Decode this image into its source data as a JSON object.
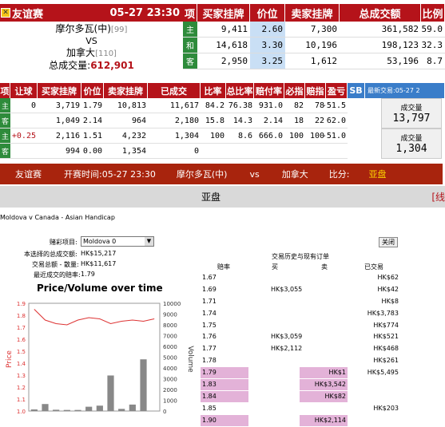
{
  "match_header": {
    "league": "友谊赛",
    "time": "05-27 23:30"
  },
  "teams": {
    "home": "摩尔多瓦(中)",
    "home_rank": "[99]",
    "vs": "VS",
    "away": "加拿大",
    "away_rank": "[110]",
    "total_label": "总成交量:",
    "total_value": "612,901"
  },
  "top_headers": {
    "item": "项",
    "buy": "买家挂牌",
    "price": "价位",
    "sell": "卖家挂牌",
    "volume": "总成交额",
    "ratio": "比例"
  },
  "top_rows": [
    {
      "label": "主",
      "buy": "9,411",
      "price": "2.60",
      "sell": "7,300",
      "volume": "361,582",
      "ratio": "59.0"
    },
    {
      "label": "和",
      "buy": "14,618",
      "price": "3.30",
      "sell": "10,196",
      "volume": "198,123",
      "ratio": "32.3"
    },
    {
      "label": "客",
      "buy": "2,950",
      "price": "3.25",
      "sell": "1,612",
      "volume": "53,196",
      "ratio": "8.7"
    }
  ],
  "second_headers": {
    "item": "项",
    "handicap": "让球",
    "buy": "买家挂牌",
    "price": "价位",
    "sell": "卖家挂牌",
    "done": "已成交",
    "ratio": "比率",
    "total_ratio": "总比率",
    "odds_rate": "赔付率",
    "must_win": "必指",
    "lose_idx": "赔指",
    "profit": "盈亏",
    "sb": "SB",
    "latest_label": "最新交易:",
    "latest_time": "05-27 2"
  },
  "second_rows": [
    {
      "label": "主",
      "handicap": "0",
      "buy": "3,719",
      "price": "1.79",
      "sell": "10,813",
      "done": "11,617",
      "ratio": "84.2",
      "total_ratio": "76.38",
      "odds_rate": "931.0",
      "must_win": "82",
      "lose_idx": "78",
      "profit": "-51.5"
    },
    {
      "label": "客",
      "handicap": "",
      "buy": "1,049",
      "price": "2.14",
      "sell": "964",
      "done": "2,180",
      "ratio": "15.8",
      "total_ratio": "14.3",
      "odds_rate": "2.14",
      "must_win": "18",
      "lose_idx": "22",
      "profit": "62.0"
    },
    {
      "label": "主",
      "handicap": "+0.25",
      "buy": "2,116",
      "price": "1.51",
      "sell": "4,232",
      "done": "1,304",
      "ratio": "100",
      "total_ratio": "8.6",
      "odds_rate": "666.0",
      "must_win": "100",
      "lose_idx": "100",
      "profit": "-51.0"
    },
    {
      "label": "客",
      "handicap": "",
      "buy": "994",
      "price": "0.00",
      "sell": "1,354",
      "done": "0",
      "ratio": "",
      "total_ratio": "",
      "odds_rate": "",
      "must_win": "",
      "lose_idx": "",
      "profit": ""
    }
  ],
  "volume_boxes": [
    {
      "label": "成交量",
      "value": "13,797"
    },
    {
      "label": "成交量",
      "value": "1,304"
    }
  ],
  "info_bar": {
    "league": "友谊赛",
    "start_label": "开赛时间:",
    "start_time": "05-27 23:30",
    "home": "摩尔多瓦(中)",
    "vs": "vs",
    "away": "加拿大",
    "score_label": "比分:",
    "market": "亚盘"
  },
  "section_title": "亚盘",
  "section_right": "[线",
  "detail": {
    "heading": "Moldova v Canada - Asian Handicap",
    "select_label": "赌彩项目:",
    "select_value": "Moldova 0",
    "matched_label": "本选择的总成交额:",
    "matched_value": "HK$15,217",
    "total_label": "交易总额 - 散量:",
    "total_value": "HK$11,617",
    "last_label": "最近成交的赔率:",
    "last_value": "1.79",
    "close_btn": "关闭",
    "table_title": "交易历史与现有订单",
    "col_odds": "赔率",
    "col_buy": "买",
    "col_sell": "卖",
    "col_done": "已交易",
    "rows": [
      {
        "odds": "1.67",
        "buy": "",
        "sell": "",
        "done": "HK$62"
      },
      {
        "odds": "1.69",
        "buy": "HK$3,055",
        "sell": "",
        "done": "HK$42"
      },
      {
        "odds": "1.71",
        "buy": "",
        "sell": "",
        "done": "HK$8"
      },
      {
        "odds": "1.74",
        "buy": "",
        "sell": "",
        "done": "HK$3,783"
      },
      {
        "odds": "1.75",
        "buy": "",
        "sell": "",
        "done": "HK$774"
      },
      {
        "odds": "1.76",
        "buy": "HK$3,059",
        "sell": "",
        "done": "HK$521"
      },
      {
        "odds": "1.77",
        "buy": "HK$2,112",
        "sell": "",
        "done": "HK$468"
      },
      {
        "odds": "1.78",
        "buy": "",
        "sell": "",
        "done": "HK$261"
      },
      {
        "odds": "1.79",
        "buy": "",
        "sell": "HK$1",
        "done": "HK$5,495"
      },
      {
        "odds": "1.83",
        "buy": "",
        "sell": "HK$3,542",
        "done": ""
      },
      {
        "odds": "1.84",
        "buy": "",
        "sell": "HK$82",
        "done": ""
      },
      {
        "odds": "1.85",
        "buy": "",
        "sell": "",
        "done": "HK$203"
      },
      {
        "odds": "1.90",
        "buy": "",
        "sell": "HK$2,114",
        "done": ""
      }
    ]
  },
  "chart_data": {
    "type": "line",
    "title": "Price/Volume over time",
    "ylabel": "Price",
    "y2label": "Volume",
    "ylim": [
      1.0,
      1.9
    ],
    "y2lim": [
      0,
      10000
    ],
    "price_ticks": [
      "1.9",
      "1.8",
      "1.7",
      "1.6",
      "1.5",
      "1.4",
      "1.3",
      "1.2",
      "1.1",
      "1.0"
    ],
    "volume_ticks": [
      "10000",
      "9000",
      "8000",
      "7000",
      "6000",
      "5000",
      "4000",
      "3000",
      "2000",
      "1000",
      "0"
    ],
    "series": [
      {
        "name": "Price",
        "values": [
          1.85,
          1.76,
          1.73,
          1.72,
          1.76,
          1.78,
          1.77,
          1.73,
          1.75,
          1.76,
          1.75,
          1.77
        ]
      },
      {
        "name": "Volume",
        "values": [
          150,
          650,
          120,
          100,
          100,
          400,
          500,
          3300,
          200,
          600,
          4800,
          0
        ]
      }
    ]
  }
}
